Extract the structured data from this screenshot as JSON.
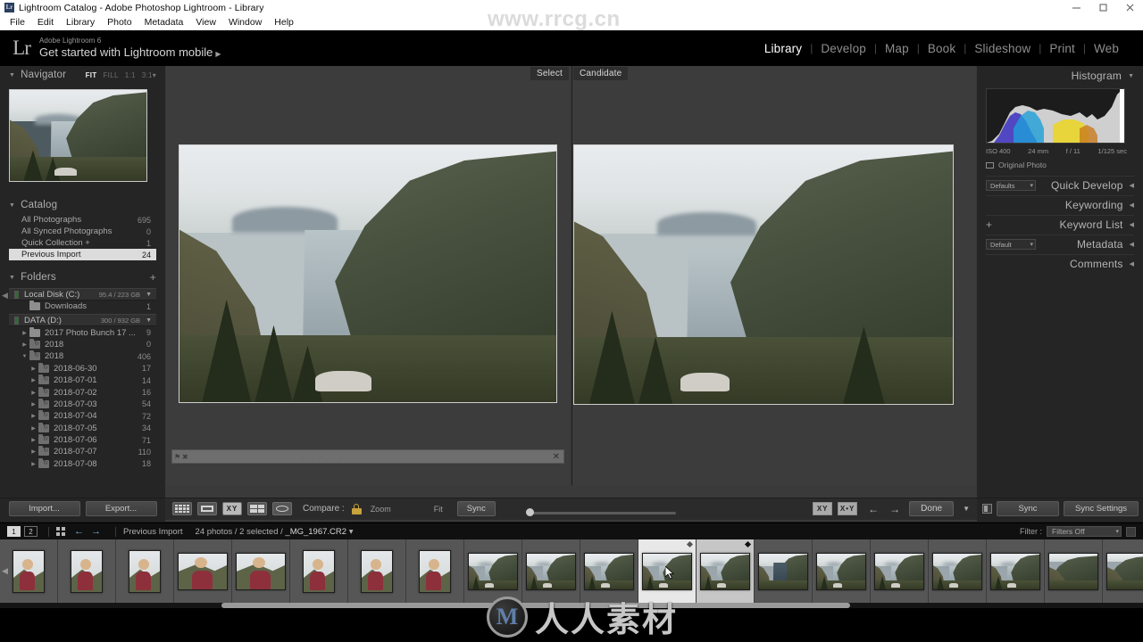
{
  "window": {
    "title": "Lightroom Catalog - Adobe Photoshop Lightroom - Library",
    "app_badge": "Lr",
    "controls": {
      "minimize": "minimize-icon",
      "maximize": "maximize-icon",
      "close": "close-icon"
    }
  },
  "menubar": [
    "File",
    "Edit",
    "Library",
    "Photo",
    "Metadata",
    "View",
    "Window",
    "Help"
  ],
  "identity": {
    "logo": "Lr",
    "small_label": "Adobe Lightroom 6",
    "big_label": "Get started with Lightroom mobile",
    "arrow": "▶"
  },
  "modules": [
    {
      "label": "Library",
      "active": true
    },
    {
      "label": "Develop",
      "active": false
    },
    {
      "label": "Map",
      "active": false
    },
    {
      "label": "Book",
      "active": false
    },
    {
      "label": "Slideshow",
      "active": false
    },
    {
      "label": "Print",
      "active": false
    },
    {
      "label": "Web",
      "active": false
    }
  ],
  "watermarks": {
    "top": "www.rrcg.cn",
    "bottom_mark": "M",
    "bottom_text": "人人素材"
  },
  "navigator": {
    "title": "Navigator",
    "zoom_options": [
      {
        "label": "FIT",
        "active": true
      },
      {
        "label": "FILL",
        "active": false
      },
      {
        "label": "1:1",
        "active": false
      },
      {
        "label": "3:1",
        "active": false
      }
    ]
  },
  "catalog": {
    "title": "Catalog",
    "items": [
      {
        "label": "All Photographs",
        "count": "695",
        "selected": false
      },
      {
        "label": "All Synced Photographs",
        "count": "0",
        "selected": false
      },
      {
        "label": "Quick Collection  +",
        "count": "1",
        "selected": false
      },
      {
        "label": "Previous Import",
        "count": "24",
        "selected": true
      }
    ]
  },
  "folders": {
    "title": "Folders",
    "add_label": "+",
    "volumes": [
      {
        "name": "Local Disk (C:)",
        "space": "95.4 / 223 GB"
      },
      {
        "name": "DATA (D:)",
        "space": "300 / 932 GB"
      }
    ],
    "rows": [
      {
        "label": "Downloads",
        "count": "1",
        "indent": 1,
        "volume": 0,
        "expandable": false,
        "synced": false
      },
      {
        "label": "2017 Photo Bunch 17 ...",
        "count": "9",
        "indent": 1,
        "volume": 1,
        "expandable": true,
        "synced": false
      },
      {
        "label": "2018",
        "count": "0",
        "indent": 1,
        "volume": 1,
        "expandable": true,
        "synced": true
      },
      {
        "label": "2018",
        "count": "406",
        "indent": 1,
        "volume": 1,
        "expandable": true,
        "expanded": true,
        "synced": true
      },
      {
        "label": "2018-06-30",
        "count": "17",
        "indent": 2,
        "volume": 1,
        "expandable": true,
        "synced": true
      },
      {
        "label": "2018-07-01",
        "count": "14",
        "indent": 2,
        "volume": 1,
        "expandable": true,
        "synced": true
      },
      {
        "label": "2018-07-02",
        "count": "16",
        "indent": 2,
        "volume": 1,
        "expandable": true,
        "synced": true
      },
      {
        "label": "2018-07-03",
        "count": "54",
        "indent": 2,
        "volume": 1,
        "expandable": true,
        "synced": true
      },
      {
        "label": "2018-07-04",
        "count": "72",
        "indent": 2,
        "volume": 1,
        "expandable": true,
        "synced": true
      },
      {
        "label": "2018-07-05",
        "count": "34",
        "indent": 2,
        "volume": 1,
        "expandable": true,
        "synced": true
      },
      {
        "label": "2018-07-06",
        "count": "71",
        "indent": 2,
        "volume": 1,
        "expandable": true,
        "synced": true
      },
      {
        "label": "2018-07-07",
        "count": "110",
        "indent": 2,
        "volume": 1,
        "expandable": true,
        "synced": true
      },
      {
        "label": "2018-07-08",
        "count": "18",
        "indent": 2,
        "volume": 1,
        "expandable": true,
        "synced": true
      }
    ]
  },
  "left_buttons": {
    "import": "Import...",
    "export": "Export..."
  },
  "compare": {
    "select_label": "Select",
    "candidate_label": "Candidate"
  },
  "histogram": {
    "title": "Histogram",
    "iso": "ISO 400",
    "focal": "24 mm",
    "aperture": "f / 11",
    "shutter": "1/125 sec",
    "original_photo": "Original Photo"
  },
  "right_panels": [
    {
      "title": "Quick Develop",
      "select_value": "Defaults",
      "has_select": true,
      "has_plus": false
    },
    {
      "title": "Keywording",
      "select_value": "",
      "has_select": false,
      "has_plus": false
    },
    {
      "title": "Keyword List",
      "select_value": "",
      "has_select": false,
      "has_plus": true
    },
    {
      "title": "Metadata",
      "select_value": "Default",
      "has_select": true,
      "has_plus": false
    },
    {
      "title": "Comments",
      "select_value": "",
      "has_select": false,
      "has_plus": false
    }
  ],
  "toolbar": {
    "view_modes": [
      {
        "name": "grid-view",
        "active": false
      },
      {
        "name": "loupe-view",
        "active": false
      },
      {
        "name": "compare-view",
        "active": true
      },
      {
        "name": "survey-view",
        "active": false
      },
      {
        "name": "people-view",
        "active": false
      }
    ],
    "compare_label": "Compare :",
    "lock_icon": "lock-icon",
    "zoom_label": "Zoom",
    "fit_label": "Fit",
    "sync_label": "Sync",
    "swap_label": "swap-icon",
    "make_select_label": "make-select-icon",
    "prev_label": "←",
    "next_label": "→",
    "done_label": "Done",
    "caret_label": "▼",
    "right_sync": "Sync",
    "right_sync_settings": "Sync Settings"
  },
  "filmstrip_bar": {
    "page_1": "1",
    "page_2": "2",
    "grid_icon": "grid-icon",
    "back_arrow": "←",
    "forward_arrow": "→",
    "source": "Previous Import",
    "status": "24 photos / 2 selected / ",
    "filename": "_MG_1967.CR2",
    "filename_caret": "▾",
    "filter_label": "Filter :",
    "filter_value": "Filters Off"
  },
  "filmstrip_thumbs": [
    {
      "kind": "portrait-person",
      "state": "normal"
    },
    {
      "kind": "portrait-person",
      "state": "normal"
    },
    {
      "kind": "portrait-person",
      "state": "normal"
    },
    {
      "kind": "landscape-person",
      "state": "normal"
    },
    {
      "kind": "landscape-person",
      "state": "normal"
    },
    {
      "kind": "portrait-person",
      "state": "normal"
    },
    {
      "kind": "portrait-person",
      "state": "normal"
    },
    {
      "kind": "portrait-person",
      "state": "normal"
    },
    {
      "kind": "valley",
      "state": "normal"
    },
    {
      "kind": "valley",
      "state": "normal"
    },
    {
      "kind": "valley",
      "state": "normal"
    },
    {
      "kind": "valley",
      "state": "selected"
    },
    {
      "kind": "valley",
      "state": "active"
    },
    {
      "kind": "river",
      "state": "normal"
    },
    {
      "kind": "valley",
      "state": "normal"
    },
    {
      "kind": "valley",
      "state": "normal"
    },
    {
      "kind": "valley",
      "state": "normal"
    },
    {
      "kind": "valley",
      "state": "normal"
    },
    {
      "kind": "ridge",
      "state": "normal"
    },
    {
      "kind": "ridge",
      "state": "normal"
    }
  ],
  "colors": {
    "panel_bg": "#252525",
    "center_bg": "#3a3a3a",
    "accent_text": "#ffffff",
    "selection_bg": "#dcdcdc",
    "filmstrip_bg": "#4b4b4b",
    "lock_yellow": "#c8a23c"
  }
}
